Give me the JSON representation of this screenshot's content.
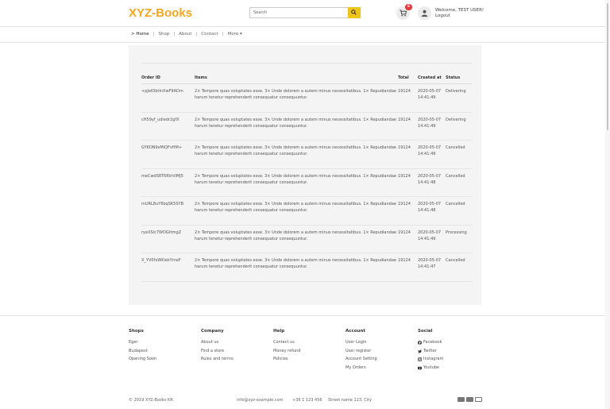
{
  "header": {
    "logo": "XYZ-Books",
    "search_placeholder": "Search",
    "cart_count": "6",
    "welcome": "Welcome, TEST USER!",
    "logout": "Logout"
  },
  "nav": {
    "home": "> Home",
    "shop": "Shop",
    "about": "About",
    "contact": "Contact",
    "more": "More ▾"
  },
  "orders": {
    "columns": {
      "id": "Order ID",
      "items": "Items",
      "total": "Total",
      "created": "Created at",
      "status": "Status"
    },
    "rows": [
      {
        "id": "+pJelObtInXwF9ADm",
        "items": "2× Tempore quas voluptates esse. 3× Unde dolorem a autem minus necessitatibus. 1× Repudiandae harum tenetur reprehenderit consequatur consequuntur.",
        "total": "19124",
        "created": "2020-05-07 14:41:49",
        "status": "Delivering"
      },
      {
        "id": "cH59yf_udiedr2gfX",
        "items": "2× Tempore quas voluptates esse. 3× Unde dolorem a autem minus necessitatibus. 1× Repudiandae harum tenetur reprehenderit consequatur consequuntur.",
        "total": "19124",
        "created": "2020-05-07 14:41:49",
        "status": "Delivering"
      },
      {
        "id": "GY6ON9sMiQFvHM+",
        "items": "2× Tempore quas voluptates esse. 3× Unde dolorem a autem minus necessitatibus. 1× Repudiandae harum tenetur reprehenderit consequatur consequuntur.",
        "total": "19124",
        "created": "2020-05-07 14:41:49",
        "status": "Cancelled"
      },
      {
        "id": "meCwdSRT6RVnIIMJ5",
        "items": "2× Tempore quas voluptates esse. 3× Unde dolorem a autem minus necessitatibus. 1× Repudiandae harum tenetur reprehenderit consequatur consequuntur.",
        "total": "19124",
        "created": "2020-05-07 14:41:48",
        "status": "Cancelled"
      },
      {
        "id": "mURL8uY6bqSK5SYB",
        "items": "2× Tempore quas voluptates esse. 3× Unde dolorem a autem minus necessitatibus. 1× Repudiandae harum tenetur reprehenderit consequatur consequuntur.",
        "total": "19124",
        "created": "2020-05-07 14:41:48",
        "status": "Cancelled"
      },
      {
        "id": "ryeXSlc7WOGttmgZ",
        "items": "2× Tempore quas voluptates esse. 3× Unde dolorem a autem minus necessitatibus. 1× Repudiandae harum tenetur reprehenderit consequatur consequuntur.",
        "total": "19124",
        "created": "2020-05-07 14:41:49",
        "status": "Processing"
      },
      {
        "id": "X_YV0fxWKiekYmsP",
        "items": "2× Tempore quas voluptates esse. 3× Unde dolorem a autem minus necessitatibus. 1× Repudiandae harum tenetur reprehenderit consequatur consequuntur.",
        "total": "19124",
        "created": "2020-05-07 14:41:47",
        "status": "Cancelled"
      }
    ]
  },
  "footer": {
    "shops": {
      "title": "Shops",
      "items": [
        "Eger",
        "Budapest",
        "Opening Soon"
      ]
    },
    "company": {
      "title": "Company",
      "items": [
        "About us",
        "Find a store",
        "Rules and terms"
      ]
    },
    "help": {
      "title": "Help",
      "items": [
        "Contact us",
        "Money refund",
        "Policies"
      ]
    },
    "account": {
      "title": "Account",
      "items": [
        "User Login",
        "User register",
        "Account Setting",
        "My Orders"
      ]
    },
    "social": {
      "title": "Social",
      "items": [
        "Facebook",
        "Twitter",
        "Instagram",
        "Youtube"
      ]
    },
    "copyright": "© 2019 XYZ-Books Kft.",
    "email": "info@xyz-example.com",
    "phone": "+36 1 123 456",
    "address": "Street name 123, City"
  },
  "colors": {
    "brand": "#f5a623",
    "search_button": "#f0c419",
    "badge": "#e8373c"
  }
}
